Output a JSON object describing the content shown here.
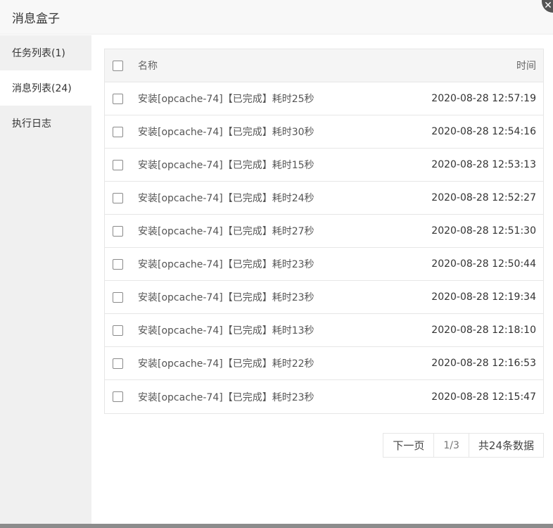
{
  "dialog": {
    "title": "消息盒子",
    "close_glyph": "✕"
  },
  "sidebar": {
    "items": [
      {
        "label": "任务列表(1)"
      },
      {
        "label": "消息列表(24)"
      },
      {
        "label": "执行日志"
      }
    ]
  },
  "table": {
    "header": {
      "name": "名称",
      "time": "时间"
    },
    "rows": [
      {
        "name": "安装[opcache-74]【已完成】耗时25秒",
        "time": "2020-08-28 12:57:19"
      },
      {
        "name": "安装[opcache-74]【已完成】耗时30秒",
        "time": "2020-08-28 12:54:16"
      },
      {
        "name": "安装[opcache-74]【已完成】耗时15秒",
        "time": "2020-08-28 12:53:13"
      },
      {
        "name": "安装[opcache-74]【已完成】耗时24秒",
        "time": "2020-08-28 12:52:27"
      },
      {
        "name": "安装[opcache-74]【已完成】耗时27秒",
        "time": "2020-08-28 12:51:30"
      },
      {
        "name": "安装[opcache-74]【已完成】耗时23秒",
        "time": "2020-08-28 12:50:44"
      },
      {
        "name": "安装[opcache-74]【已完成】耗时23秒",
        "time": "2020-08-28 12:19:34"
      },
      {
        "name": "安装[opcache-74]【已完成】耗时13秒",
        "time": "2020-08-28 12:18:10"
      },
      {
        "name": "安装[opcache-74]【已完成】耗时22秒",
        "time": "2020-08-28 12:16:53"
      },
      {
        "name": "安装[opcache-74]【已完成】耗时23秒",
        "time": "2020-08-28 12:15:47"
      }
    ]
  },
  "pager": {
    "next_label": "下一页",
    "page": "1/3",
    "total": "共24条数据"
  }
}
